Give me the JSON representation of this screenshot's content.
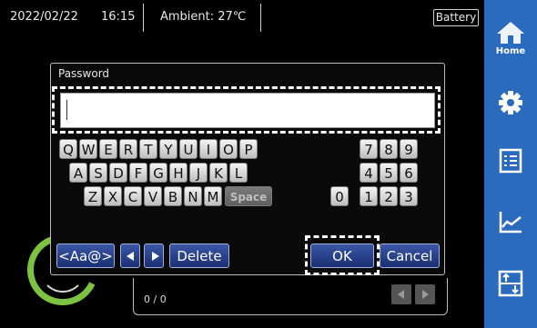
{
  "status_bar": {
    "date": "2022/02/22",
    "time": "16:15",
    "ambient": "Ambient: 27℃",
    "battery": "Battery"
  },
  "nav": {
    "home_label": "Home",
    "items": [
      "home-icon",
      "gear-icon",
      "checklist-icon",
      "trend-chart-icon",
      "transfer-icon"
    ],
    "background": "#2b6bbd"
  },
  "background": {
    "page_counter": "0 / 0",
    "gauge_color": "#7dc242"
  },
  "dialog": {
    "title": "Password",
    "password_value": "",
    "rows": [
      [
        "Q",
        "W",
        "E",
        "R",
        "T",
        "Y",
        "U",
        "I",
        "O",
        "P"
      ],
      [
        "A",
        "S",
        "D",
        "F",
        "G",
        "H",
        "J",
        "K",
        "L"
      ],
      [
        "Z",
        "X",
        "C",
        "V",
        "B",
        "N",
        "M"
      ]
    ],
    "space_label": "Space",
    "numpad": [
      [
        "7",
        "8",
        "9"
      ],
      [
        "4",
        "5",
        "6"
      ],
      [
        "0",
        "1",
        "2",
        "3"
      ]
    ],
    "mode_button": "<Aa@>",
    "delete_button": "Delete",
    "ok_button": "OK",
    "cancel_button": "Cancel",
    "button_color": "#1b2f73"
  }
}
